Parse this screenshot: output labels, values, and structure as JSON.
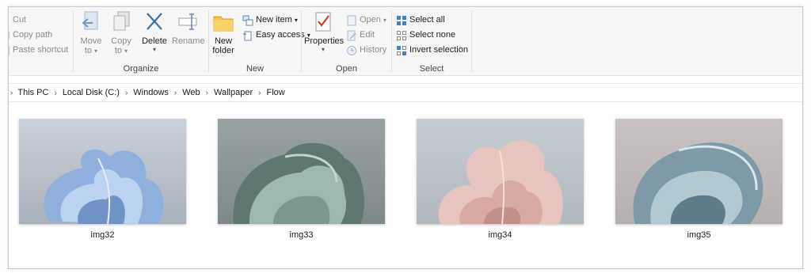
{
  "clipboard": {
    "cut": "Cut",
    "copy_path": "Copy path",
    "paste_shortcut": "Paste shortcut"
  },
  "organize": {
    "move_to_line1": "Move",
    "move_to_line2": "to",
    "copy_to_line1": "Copy",
    "copy_to_line2": "to",
    "delete": "Delete",
    "rename": "Rename",
    "label": "Organize"
  },
  "new_group": {
    "new_folder_line1": "New",
    "new_folder_line2": "folder",
    "new_item": "New item",
    "easy_access": "Easy access",
    "label": "New"
  },
  "open_group": {
    "properties": "Properties",
    "open": "Open",
    "edit": "Edit",
    "history": "History",
    "label": "Open"
  },
  "select_group": {
    "select_all": "Select all",
    "select_none": "Select none",
    "invert_selection": "Invert selection",
    "label": "Select"
  },
  "breadcrumb": [
    "This PC",
    "Local Disk (C:)",
    "Windows",
    "Web",
    "Wallpaper",
    "Flow"
  ],
  "files": [
    {
      "name": "img32",
      "icon": "blue-flow-image"
    },
    {
      "name": "img33",
      "icon": "green-flow-image"
    },
    {
      "name": "img34",
      "icon": "pink-flow-image"
    },
    {
      "name": "img35",
      "icon": "teal-flow-image"
    }
  ],
  "colors": {
    "accent": "#1e6fc9",
    "ribbon_bg": "#f6f6f6"
  }
}
